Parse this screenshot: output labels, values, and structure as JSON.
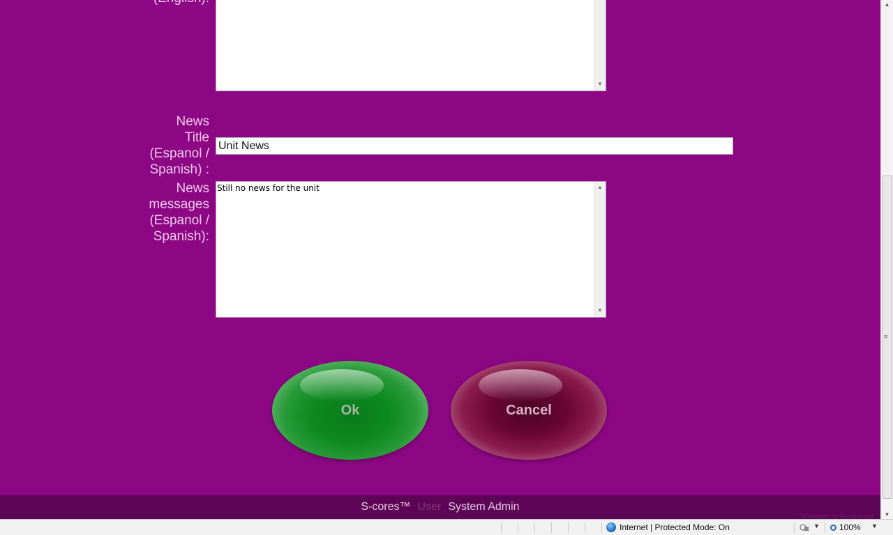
{
  "form": {
    "title_label": "News\nTitle\n(Espanol /\nSpanish) :",
    "title_value": "Unit News",
    "messages_label": "News\nmessages\n(Espanol /\nSpanish):",
    "messages_value": "Still no news for the unit"
  },
  "buttons": {
    "ok": "Ok",
    "cancel": "Cancel"
  },
  "footer": {
    "brand": "S-cores™",
    "user_label": "User",
    "user_name": "System Admin",
    "developed_by": "Developed by Paragonsoft"
  },
  "statusbar": {
    "zone_text": "Internet | Protected Mode: On",
    "zoom": "100%"
  }
}
